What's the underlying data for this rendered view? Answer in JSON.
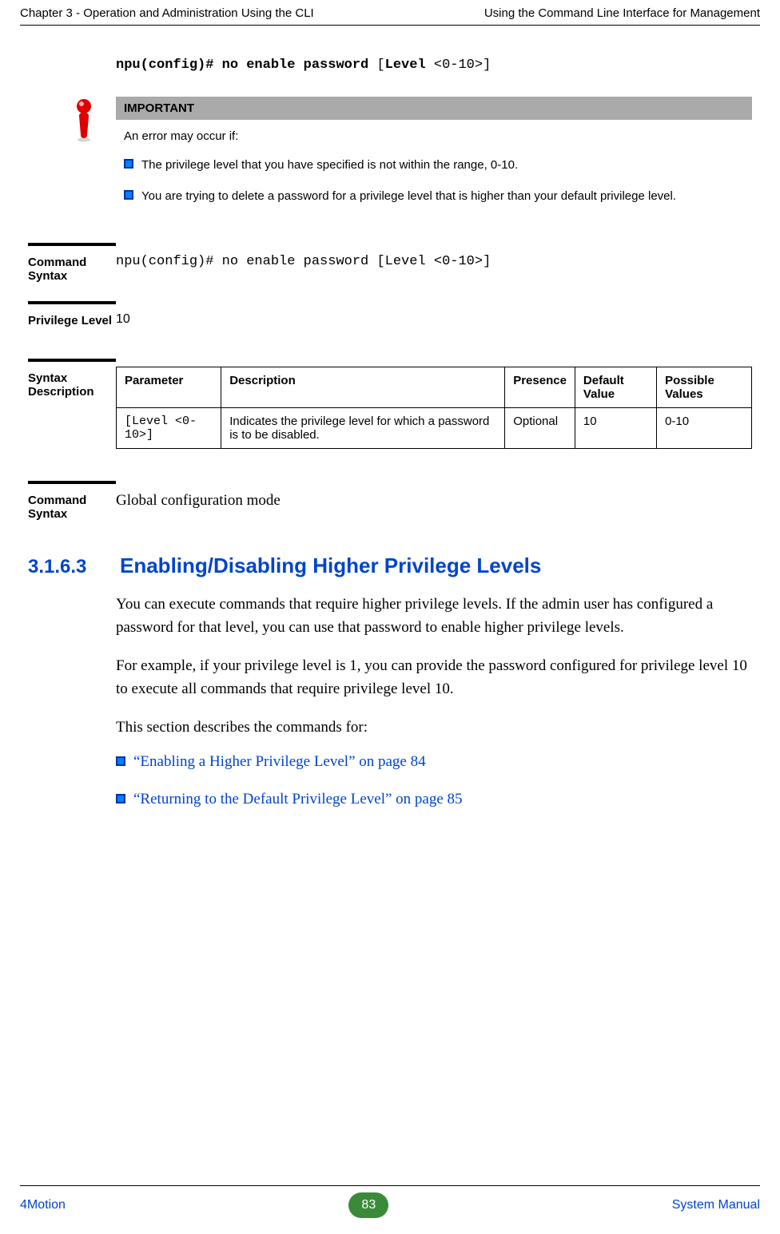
{
  "header": {
    "left": "Chapter 3 - Operation and Administration Using the CLI",
    "right": "Using the Command Line Interface for Management"
  },
  "top_code": {
    "bold": "npu(config)# no enable password ",
    "normal_open": "[",
    "bold2": "Level ",
    "normal_close": "<0-10>]"
  },
  "important": {
    "title": "IMPORTANT",
    "intro": "An error may occur if:",
    "items": [
      "The privilege level that you have specified is not within the range, 0-10.",
      "You are trying to delete a password for a privilege level that is higher than your default privilege level."
    ]
  },
  "command_syntax": {
    "label": "Command Syntax",
    "bold": "npu(config)# no enable password ",
    "normal_open": "[",
    "bold2": "Level ",
    "normal_close": "<0-10>]"
  },
  "privilege_level": {
    "label": "Privilege Level",
    "value": "10"
  },
  "syntax_description": {
    "label": "Syntax Description",
    "headers": {
      "parameter": "Parameter",
      "description": "Description",
      "presence": "Presence",
      "default_value": "Default Value",
      "possible_values": "Possible Values"
    },
    "row": {
      "parameter": "[Level <0-10>]",
      "description": "Indicates the privilege level for which a password is to be disabled.",
      "presence": "Optional",
      "default_value": "10",
      "possible_values": "0-10"
    }
  },
  "command_mode": {
    "label": "Command Syntax",
    "value": "Global configuration mode"
  },
  "section": {
    "number": "3.1.6.3",
    "title": "Enabling/Disabling Higher Privilege Levels",
    "p1": "You can execute commands that require higher privilege levels. If the admin user has configured a password for that level, you can use that password to enable higher privilege levels.",
    "p2": "For example, if your privilege level is 1, you can provide the password configured for privilege level 10 to execute all commands that require privilege level 10.",
    "p3": "This section describes the commands for:",
    "links": [
      "“Enabling a Higher Privilege Level” on page 84",
      "“Returning to the Default Privilege Level” on page 85"
    ]
  },
  "footer": {
    "left": "4Motion",
    "page": "83",
    "right": "System Manual"
  }
}
